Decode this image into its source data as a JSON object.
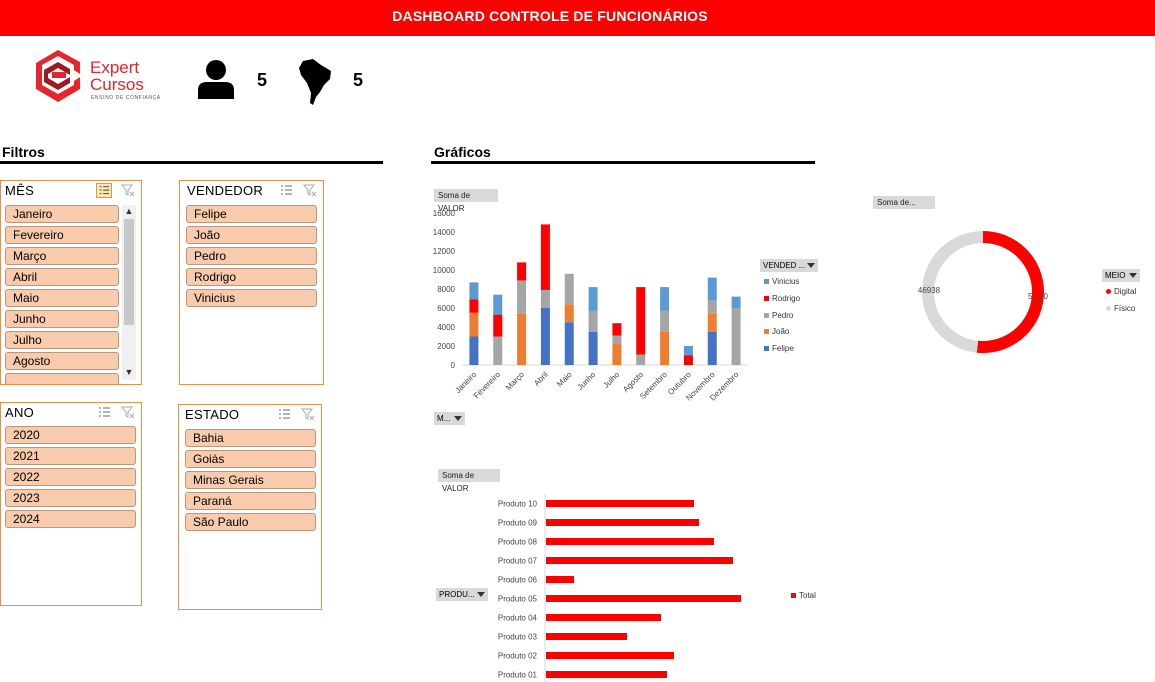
{
  "header": {
    "title": "DASHBOARD CONTROLE DE FUNCIONÁRIOS"
  },
  "logo": {
    "line1": "Expert",
    "line2": "Cursos",
    "tagline": "ENSINO DE CONFIANÇA"
  },
  "kpis": {
    "vendedores": "5",
    "estados": "5"
  },
  "sections": {
    "filtros": "Filtros",
    "graficos": "Gráficos"
  },
  "slicers": {
    "mes": {
      "title": "MÊS",
      "items": [
        "Janeiro",
        "Fevereiro",
        "Março",
        "Abril",
        "Maio",
        "Junho",
        "Julho",
        "Agosto"
      ]
    },
    "vendedor": {
      "title": "VENDEDOR",
      "items": [
        "Felipe",
        "João",
        "Pedro",
        "Rodrigo",
        "Vinicius"
      ]
    },
    "ano": {
      "title": "ANO",
      "items": [
        "2020",
        "2021",
        "2022",
        "2023",
        "2024"
      ]
    },
    "estado": {
      "title": "ESTADO",
      "items": [
        "Bahia",
        "Goiás",
        "Minas Gerais",
        "Paraná",
        "São Paulo"
      ]
    }
  },
  "pivot": {
    "soma_valor": "Soma de VALOR",
    "soma_short": "Soma de...",
    "vendedor_field": "VENDED ...",
    "mes_field": "M...",
    "meio_field": "MEIO",
    "produto_field": "PRODU..."
  },
  "colors": {
    "red": "#ff0000",
    "vinicius": "#5b9bd5",
    "rodrigo": "#ff0000",
    "pedro": "#a5a5a5",
    "joao": "#ed7d31",
    "felipe": "#4472c4",
    "fisico": "#d9d9d9"
  },
  "chart_data": [
    {
      "type": "bar",
      "stacked": true,
      "categories": [
        "Janeiro",
        "Fevereiro",
        "Março",
        "Abril",
        "Maio",
        "Junho",
        "Julho",
        "Agosto",
        "Setembro",
        "Outubro",
        "Novembro",
        "Dezembro"
      ],
      "series": [
        {
          "name": "Felipe",
          "values": [
            3000,
            0,
            0,
            6000,
            4500,
            3500,
            0,
            0,
            0,
            0,
            3500,
            0
          ]
        },
        {
          "name": "João",
          "values": [
            2500,
            0,
            5400,
            0,
            1900,
            0,
            2200,
            0,
            3500,
            0,
            1900,
            0
          ]
        },
        {
          "name": "Pedro",
          "values": [
            0,
            3000,
            3500,
            1900,
            3200,
            2200,
            900,
            1100,
            2200,
            0,
            1400,
            6000
          ]
        },
        {
          "name": "Rodrigo",
          "values": [
            1400,
            2300,
            1900,
            6900,
            0,
            0,
            1300,
            7100,
            0,
            1000,
            0,
            0
          ]
        },
        {
          "name": "Vinicius",
          "values": [
            1800,
            2100,
            0,
            0,
            0,
            2500,
            0,
            0,
            2500,
            1000,
            2400,
            1200
          ]
        }
      ],
      "ylim": [
        0,
        16000
      ],
      "yticks": [
        "0",
        "2000",
        "4000",
        "6000",
        "8000",
        "10000",
        "12000",
        "14000",
        "16000"
      ],
      "legend_position": "right"
    },
    {
      "type": "pie",
      "donut": true,
      "labels": [
        "Digital",
        "Físico"
      ],
      "values": [
        50000,
        46938
      ],
      "value_labels": [
        "5...50",
        "46938"
      ],
      "legend_position": "right"
    },
    {
      "type": "bar",
      "orientation": "horizontal",
      "categories": [
        "Produto 10",
        "Produto 09",
        "Produto 08",
        "Produto 07",
        "Produto 06",
        "Produto 05",
        "Produto 04",
        "Produto 03",
        "Produto 02",
        "Produto 01"
      ],
      "series": [
        {
          "name": "Total",
          "values": [
            148,
            153,
            168,
            187,
            28,
            195,
            115,
            81,
            128,
            121
          ]
        }
      ],
      "legend_position": "right"
    }
  ]
}
